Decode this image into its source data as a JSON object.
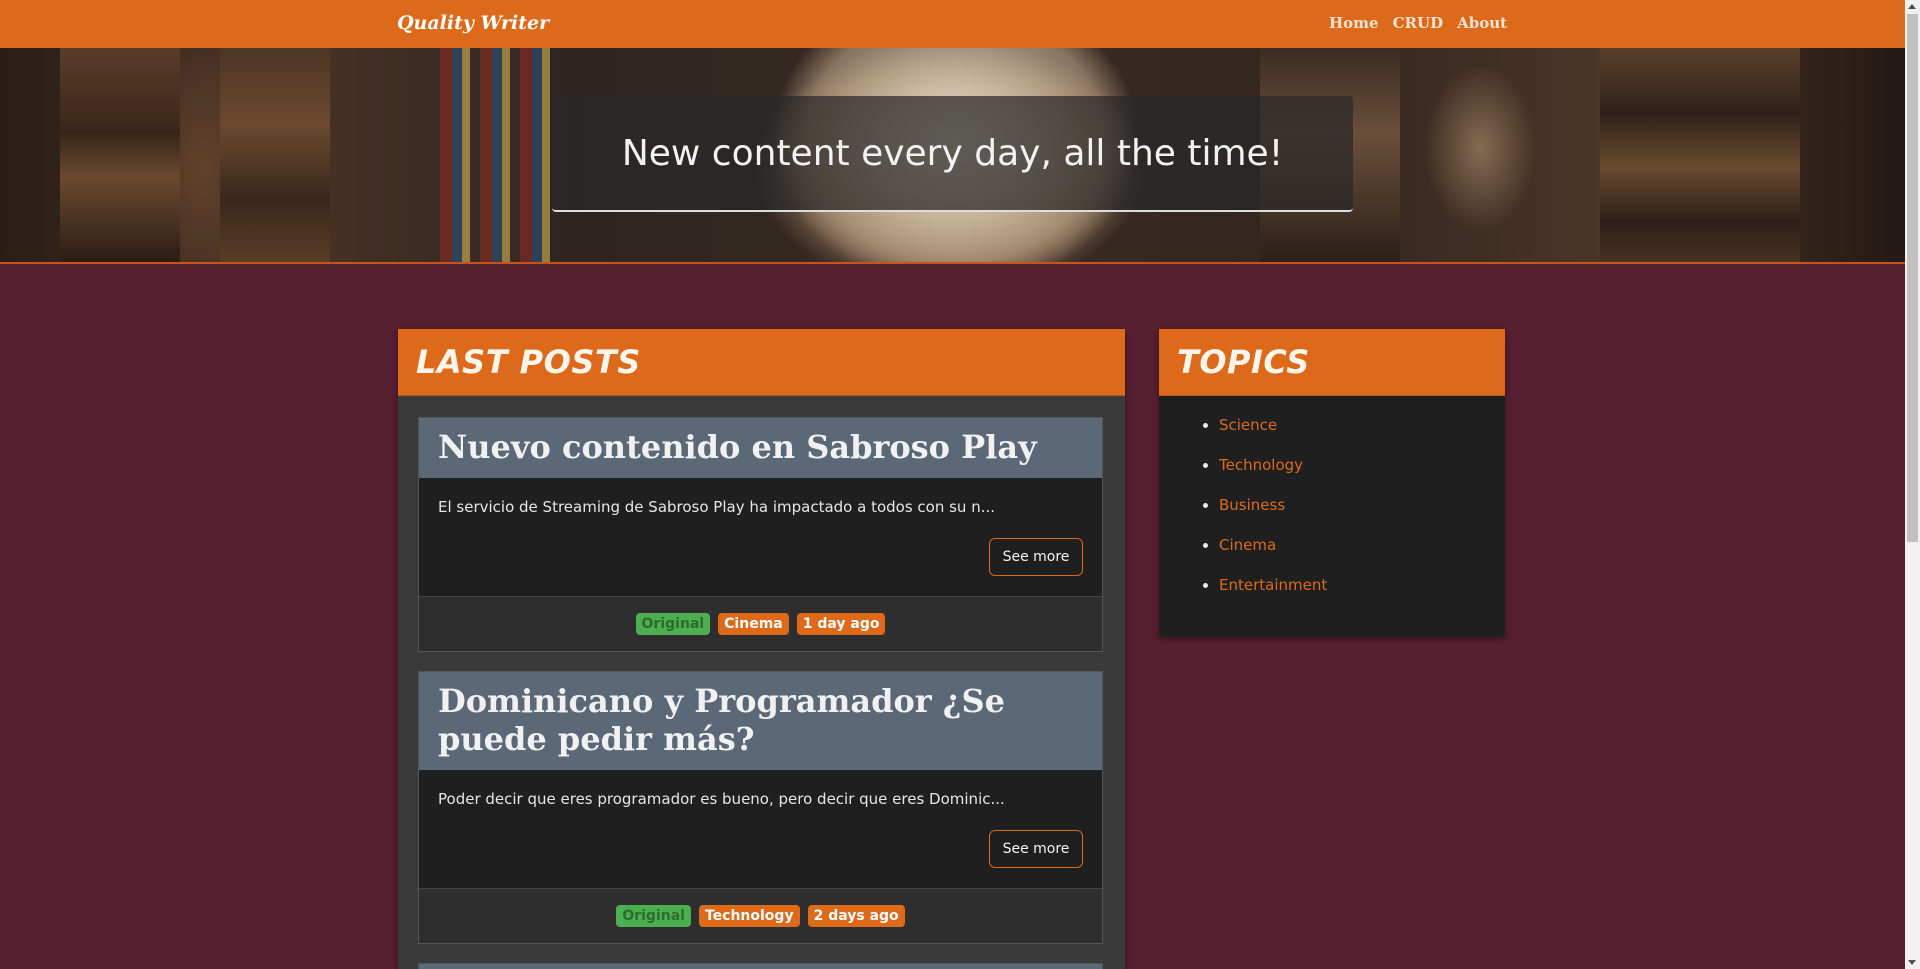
{
  "navbar": {
    "brand": "Quality Writer",
    "links": [
      {
        "label": "Home"
      },
      {
        "label": "CRUD"
      },
      {
        "label": "About"
      }
    ],
    "color": "#dd6a1b"
  },
  "hero": {
    "text": "New content every day, all the time!"
  },
  "posts_panel": {
    "title": "LAST POSTS",
    "posts": [
      {
        "title": "Nuevo contenido en Sabroso Play",
        "excerpt": "El servicio de Streaming de Sabroso Play ha impactado a todos con su n...",
        "button": "See more",
        "badges": [
          "Original",
          "Cinema",
          "1 day ago"
        ]
      },
      {
        "title": "Dominicano y Programador ¿Se puede pedir más?",
        "excerpt": "Poder decir que eres programador es bueno, pero decir que eres Dominic...",
        "button": "See more",
        "badges": [
          "Original",
          "Technology",
          "2 days ago"
        ]
      }
    ]
  },
  "topics_panel": {
    "title": "TOPICS",
    "items": [
      "Science",
      "Technology",
      "Business",
      "Cinema",
      "Entertainment"
    ]
  },
  "colors": {
    "accent": "#dd6a1b",
    "background": "#561f2f",
    "card_header": "#5b6877",
    "badge_green": "#4caf50"
  }
}
